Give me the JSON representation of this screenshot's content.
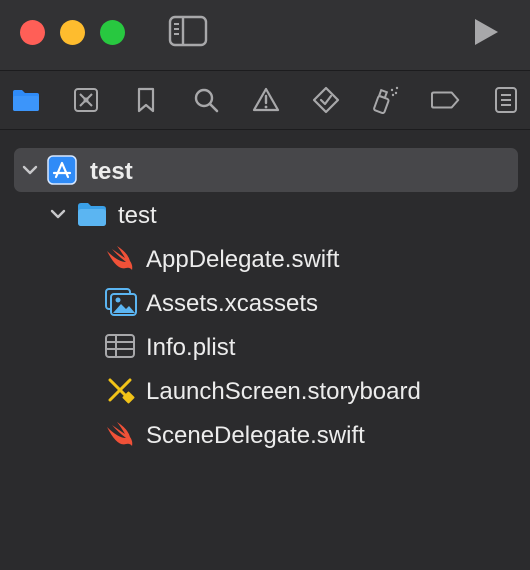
{
  "window": {
    "controls": [
      "close",
      "minimize",
      "zoom"
    ]
  },
  "toolbar": {
    "icons": [
      "sidebar-toggle-icon",
      "run-icon"
    ]
  },
  "navigator_tabs": [
    {
      "name": "project-navigator",
      "icon": "folder-icon",
      "active": true
    },
    {
      "name": "source-control-navigator",
      "icon": "source-control-icon"
    },
    {
      "name": "bookmark-navigator",
      "icon": "bookmark-icon"
    },
    {
      "name": "find-navigator",
      "icon": "search-icon"
    },
    {
      "name": "issue-navigator",
      "icon": "warning-icon"
    },
    {
      "name": "test-navigator",
      "icon": "test-diamond-icon"
    },
    {
      "name": "debug-navigator",
      "icon": "spray-icon"
    },
    {
      "name": "breakpoint-navigator",
      "icon": "breakpoint-tag-icon"
    },
    {
      "name": "report-navigator",
      "icon": "report-list-icon"
    }
  ],
  "tree": {
    "project": {
      "label": "test",
      "icon": "app-project-icon",
      "expanded": true,
      "selected": true
    },
    "group": {
      "label": "test",
      "icon": "folder-icon",
      "expanded": true
    },
    "files": [
      {
        "label": "AppDelegate.swift",
        "icon": "swift-icon"
      },
      {
        "label": "Assets.xcassets",
        "icon": "image-assets-icon"
      },
      {
        "label": "Info.plist",
        "icon": "table-icon"
      },
      {
        "label": "LaunchScreen.storyboard",
        "icon": "storyboard-icon"
      },
      {
        "label": "SceneDelegate.swift",
        "icon": "swift-icon"
      }
    ]
  },
  "colors": {
    "accent": "#2f8bf7",
    "swift": "#f05138",
    "storyboard": "#f2c318",
    "red_light": "#ff5f57",
    "yellow_light": "#febc2e",
    "green_light": "#28c840"
  }
}
